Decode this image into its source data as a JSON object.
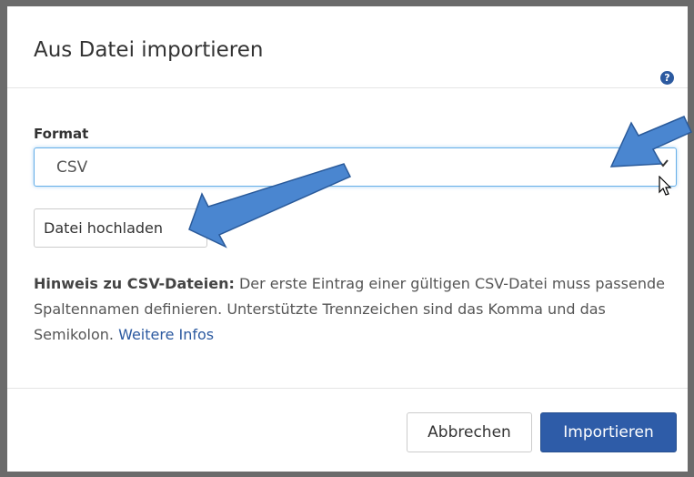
{
  "dialog": {
    "title": "Aus Datei importieren",
    "help_icon": "question-circle-icon"
  },
  "format": {
    "label": "Format",
    "selected_value": "CSV",
    "dropdown_icon": "chevron-down-icon"
  },
  "upload_button_label": "Datei hochladen",
  "hint": {
    "bold_prefix": "Hinweis zu CSV-Dateien:",
    "text": " Der erste Eintrag einer gültigen CSV-Datei muss passende Spaltennamen definieren. Unterstützte Trennzeichen sind das Komma und das Semikolon. ",
    "link": "Weitere Infos"
  },
  "footer": {
    "cancel_label": "Abbrechen",
    "import_label": "Importieren"
  },
  "colors": {
    "primary": "#2e5ca8",
    "link": "#2c5aa0",
    "focus_border": "#66afe9",
    "annotation_arrow": "#4a86d0"
  }
}
